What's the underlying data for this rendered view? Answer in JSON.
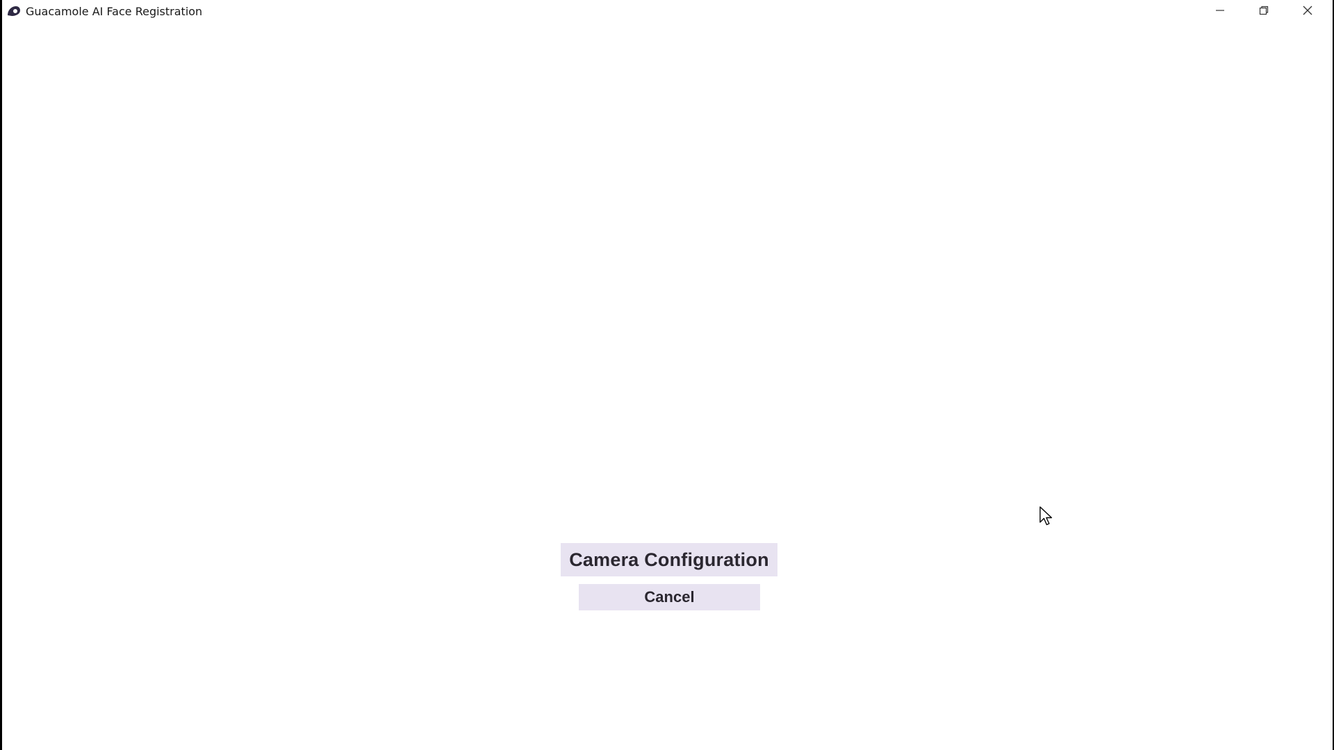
{
  "window": {
    "title": "Guacamole AI Face Registration",
    "app_icon": "guacamole-app-icon",
    "controls": {
      "minimize_icon": "minimize-icon",
      "maximize_icon": "restore-icon",
      "close_icon": "close-icon"
    }
  },
  "main": {
    "primary_button_label": "Camera Configuration",
    "cancel_button_label": "Cancel"
  },
  "colors": {
    "button_bg": "#e8e3f1",
    "button_text": "#2b2730",
    "window_bg": "#ffffff"
  }
}
